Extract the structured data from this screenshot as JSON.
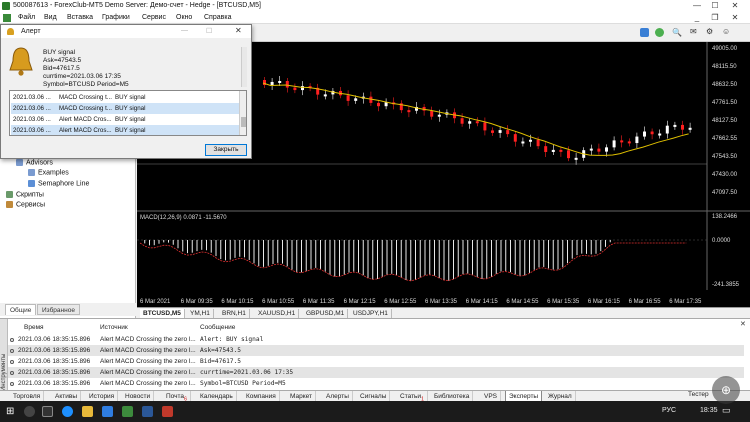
{
  "window": {
    "title": "500087613 - ForexClub-MT5 Demo Server: Демо-счет - Hedge - [BTCUSD,M5]"
  },
  "menu": [
    "Файл",
    "Вид",
    "Вставка",
    "Графики",
    "Сервис",
    "Окно",
    "Справка"
  ],
  "navigator": {
    "items": [
      {
        "label": "Advisors"
      },
      {
        "label": "Examples"
      },
      {
        "label": "Semaphore Line"
      },
      {
        "label": "Скрипты"
      },
      {
        "label": "Сервисы"
      }
    ],
    "tabs": [
      "Общие",
      "Избранное"
    ]
  },
  "alert": {
    "title": "Алерт",
    "message": "BUY signal\nAsk=47543.5\nBid=47617.5\ncurrtime=2021.03.06 17:35\nSymbol=BTCUSD Period=M5",
    "rows": [
      {
        "time": "2021.03.06 ...",
        "source": "MACD Crossing t...",
        "message": "BUY signal"
      },
      {
        "time": "2021.03.06 ...",
        "source": "MACD Crossing t...",
        "message": "BUY signal"
      },
      {
        "time": "2021.03.06 ...",
        "source": "Alert MACD Cros...",
        "message": "BUY signal"
      },
      {
        "time": "2021.03.06 ...",
        "source": "Alert MACD Cros...",
        "message": "BUY signal"
      }
    ],
    "close_label": "Закрыть"
  },
  "chart": {
    "price_labels": [
      "49005.00",
      "48115.50",
      "48632.50",
      "47761.50",
      "48127.50",
      "47662.55",
      "47543.50",
      "47430.00",
      "47097.50"
    ],
    "indicator_label": "MACD(12,26,9) 0.0871 -11.5670",
    "indicator_levels": [
      "138.2466",
      "0.0000",
      "-241.3855"
    ],
    "time_labels": [
      "6 Mar 2021",
      "6 Mar 09:35",
      "6 Mar 10:15",
      "6 Mar 10:55",
      "6 Mar 11:35",
      "6 Mar 12:15",
      "6 Mar 12:55",
      "6 Mar 13:35",
      "6 Mar 14:15",
      "6 Mar 14:55",
      "6 Mar 15:35",
      "6 Mar 16:15",
      "6 Mar 16:55",
      "6 Mar 17:35"
    ],
    "tabs": [
      "BTCUSD,M5",
      "YM,H1",
      "BRN,H1",
      "XAUUSD,H1",
      "GBPUSD,M1",
      "USDJPY,H1"
    ],
    "colors": {
      "bull": "#ffffff",
      "bear": "#ff2020",
      "ma": "#e0c000",
      "bid": "#808080"
    }
  },
  "log": {
    "headers": [
      "Время",
      "Источник",
      "Сообщение"
    ],
    "rows": [
      {
        "time": "2021.03.06 18:35:15.896",
        "source": "Alert MACD Crossing the zero l...",
        "message": "Alert: BUY signal"
      },
      {
        "time": "2021.03.06 18:35:15.896",
        "source": "Alert MACD Crossing the zero l...",
        "message": "Ask=47543.5"
      },
      {
        "time": "2021.03.06 18:35:15.896",
        "source": "Alert MACD Crossing the zero l...",
        "message": "Bid=47617.5"
      },
      {
        "time": "2021.03.06 18:35:15.896",
        "source": "Alert MACD Crossing the zero l...",
        "message": "currtime=2021.03.06 17:35"
      },
      {
        "time": "2021.03.06 18:35:15.896",
        "source": "Alert MACD Crossing the zero l...",
        "message": "Symbol=BTCUSD Period=M5"
      }
    ]
  },
  "terminal_tabs": [
    "Торговля",
    "Активы",
    "История",
    "Новости",
    "Почта",
    "Календарь",
    "Компания",
    "Маркет",
    "Алерты",
    "Сигналы",
    "Статьи",
    "Библиотека",
    "VPS",
    "Эксперты",
    "Журнал"
  ],
  "terminal_tab_badges": {
    "Почта": "6",
    "Статьи": "1"
  },
  "active_terminal_tab": "Эксперты",
  "side_label": "Инструменты",
  "taskbar": {
    "tray_text": "Тестер",
    "lang": "РУС",
    "time": "18:35"
  }
}
